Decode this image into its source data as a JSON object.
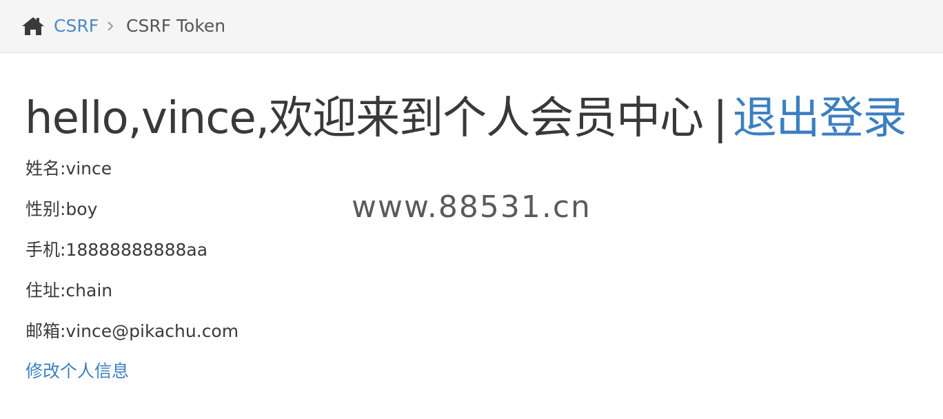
{
  "breadcrumb": {
    "home_icon": "home-icon",
    "parent_label": "CSRF",
    "separator_icon": "chevron-right-icon",
    "current_label": "CSRF Token"
  },
  "header": {
    "greeting": "hello,vince,欢迎来到个人会员中心",
    "separator": "|",
    "logout_label": "退出登录"
  },
  "profile": {
    "name": "姓名:vince",
    "gender": "性别:boy",
    "phone": "手机:18888888888aa",
    "address": "住址:chain",
    "email": "邮箱:vince@pikachu.com"
  },
  "edit_label": "修改个人信息",
  "watermark": "www.88531.cn",
  "colors": {
    "link": "#3c7fc2",
    "text": "#393939",
    "breadcrumb_bg": "#f5f5f5"
  }
}
